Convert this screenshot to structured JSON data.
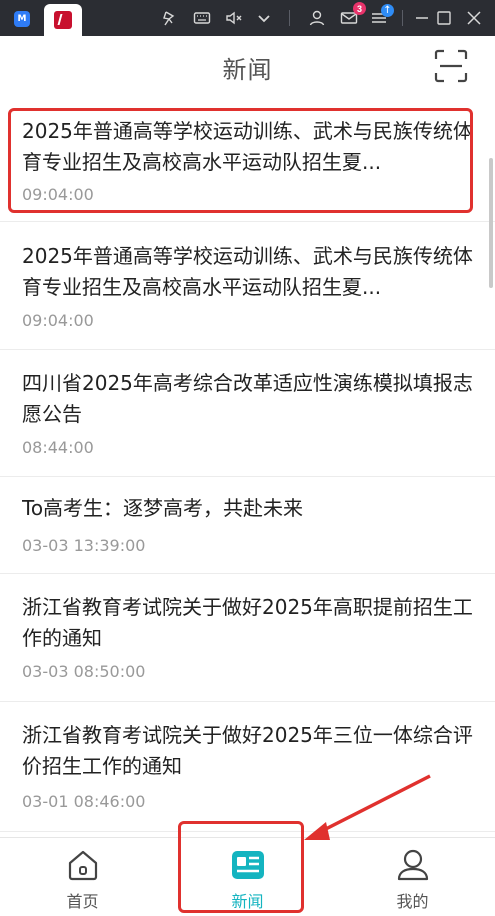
{
  "window_bar": {
    "tabs": [
      {
        "icon": "app-logo-icon",
        "logo_text": "M"
      },
      {
        "icon": "gaokao-app-icon"
      }
    ],
    "icons": [
      "pin-icon",
      "keyboard-icon",
      "mute-icon",
      "chevron-down-icon",
      "user-icon",
      "mail-icon",
      "menu-icon",
      "minimize-icon",
      "maximize-icon",
      "close-icon"
    ],
    "mail_badge": "3",
    "update_badge": "↑"
  },
  "header": {
    "title": "新闻",
    "scan_icon": "scan-icon"
  },
  "news": [
    {
      "title": "2025年普通高等学校运动训练、武术与民族传统体育专业招生及高校高水平运动队招生夏...",
      "time": "09:04:00",
      "highlighted": true
    },
    {
      "title": "2025年普通高等学校运动训练、武术与民族传统体育专业招生及高校高水平运动队招生夏...",
      "time": "09:04:00",
      "highlighted": false
    },
    {
      "title": "四川省2025年高考综合改革适应性演练模拟填报志愿公告",
      "time": "08:44:00",
      "highlighted": false
    },
    {
      "title": "To高考生：逐梦高考，共赴未来",
      "time": "03-03 13:39:00",
      "highlighted": false
    },
    {
      "title": "浙江省教育考试院关于做好2025年高职提前招生工作的通知",
      "time": "03-03 08:50:00",
      "highlighted": false
    },
    {
      "title": "浙江省教育考试院关于做好2025年三位一体综合评价招生工作的通知",
      "time": "03-01 08:46:00",
      "highlighted": false
    }
  ],
  "bottom_nav": [
    {
      "label": "首页",
      "icon": "home-icon",
      "active": false
    },
    {
      "label": "新闻",
      "icon": "news-icon",
      "active": true
    },
    {
      "label": "我的",
      "icon": "profile-icon",
      "active": false
    }
  ],
  "colors": {
    "accent": "#14b4c0",
    "highlight": "#e0312e",
    "window_bar": "#2b2d33"
  }
}
